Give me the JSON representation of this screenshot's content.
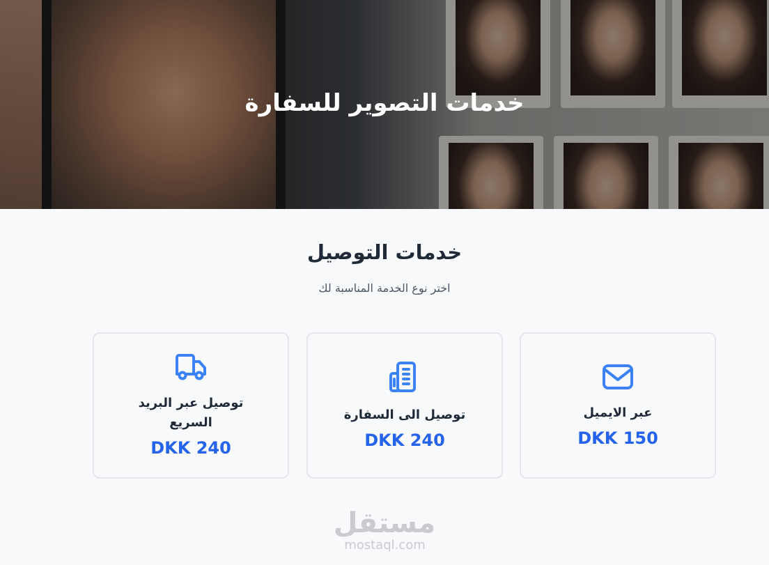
{
  "hero": {
    "title": "خدمات التصوير للسفارة"
  },
  "section": {
    "title": "خدمات التوصيل",
    "subtitle": "اختر نوع الخدمة المناسبة لك"
  },
  "cards": [
    {
      "icon": "envelope-icon",
      "label": "عبر الايميل",
      "price": "DKK 150"
    },
    {
      "icon": "building-icon",
      "label": "توصيل الى السفارة",
      "price": "DKK 240"
    },
    {
      "icon": "truck-icon",
      "label": "توصيل عبر البريد السريع",
      "price": "DKK 240"
    }
  ],
  "watermark": {
    "arabic": "مستقل",
    "latin": "mostaql.com"
  },
  "colors": {
    "accent": "#2563eb",
    "icon": "#3b82f6",
    "page_background": "#f8f9fb",
    "card_border": "#e5e7eb"
  }
}
